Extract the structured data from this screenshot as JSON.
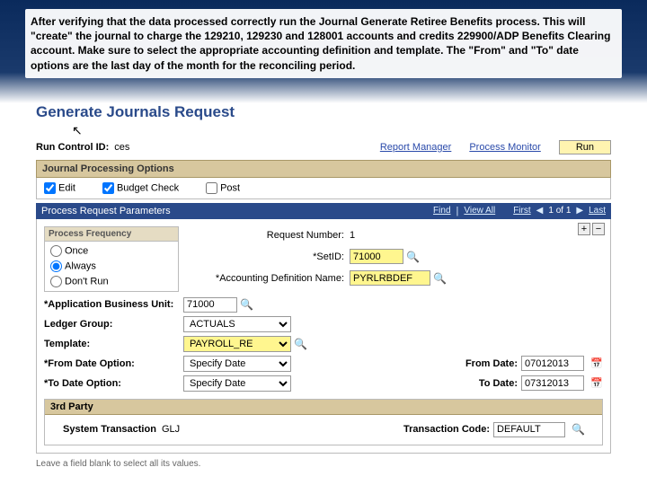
{
  "slide": {
    "instruction": "After verifying that the data processed correctly run the Journal Generate Retiree Benefits process. This will \"create\" the journal to charge the 129210, 129230 and 128001 accounts and credits 229900/ADP Benefits Clearing account. Make sure to select the appropriate accounting definition and template. The \"From\" and \"To\" date options are the last day of the month for the reconciling period."
  },
  "page": {
    "title": "Generate Journals Request",
    "run_control_label": "Run Control ID:",
    "run_control_value": "ces",
    "report_manager": "Report Manager",
    "process_monitor": "Process Monitor",
    "run_button": "Run"
  },
  "journal_options": {
    "title": "Journal Processing Options",
    "edit": "Edit",
    "budget_check": "Budget Check",
    "post": "Post"
  },
  "params": {
    "title": "Process Request Parameters",
    "find": "Find",
    "view_all": "View All",
    "first": "First",
    "counter": "1 of 1",
    "last": "Last"
  },
  "freq": {
    "title": "Process Frequency",
    "once": "Once",
    "always": "Always",
    "dont_run": "Don't Run"
  },
  "fields": {
    "request_number_label": "Request Number:",
    "request_number_value": "1",
    "setid_label": "*SetID:",
    "setid_value": "71000",
    "acct_def_label": "*Accounting Definition Name:",
    "acct_def_value": "PYRLRBDEF",
    "app_bu_label": "*Application Business Unit:",
    "app_bu_value": "71000",
    "ledger_group_label": "Ledger Group:",
    "ledger_group_value": "ACTUALS",
    "template_label": "Template:",
    "template_value": "PAYROLL_RE",
    "from_opt_label": "*From Date Option:",
    "from_opt_value": "Specify Date",
    "to_opt_label": "*To Date Option:",
    "to_opt_value": "Specify Date",
    "from_date_label": "From Date:",
    "from_date_value": "07012013",
    "to_date_label": "To Date:",
    "to_date_value": "07312013"
  },
  "third_party": {
    "title": "3rd Party",
    "sys_trans_label": "System Transaction",
    "sys_trans_value": "GLJ",
    "trans_code_label": "Transaction Code:",
    "trans_code_value": "DEFAULT"
  },
  "footnote": "Leave a field blank to select all its values."
}
